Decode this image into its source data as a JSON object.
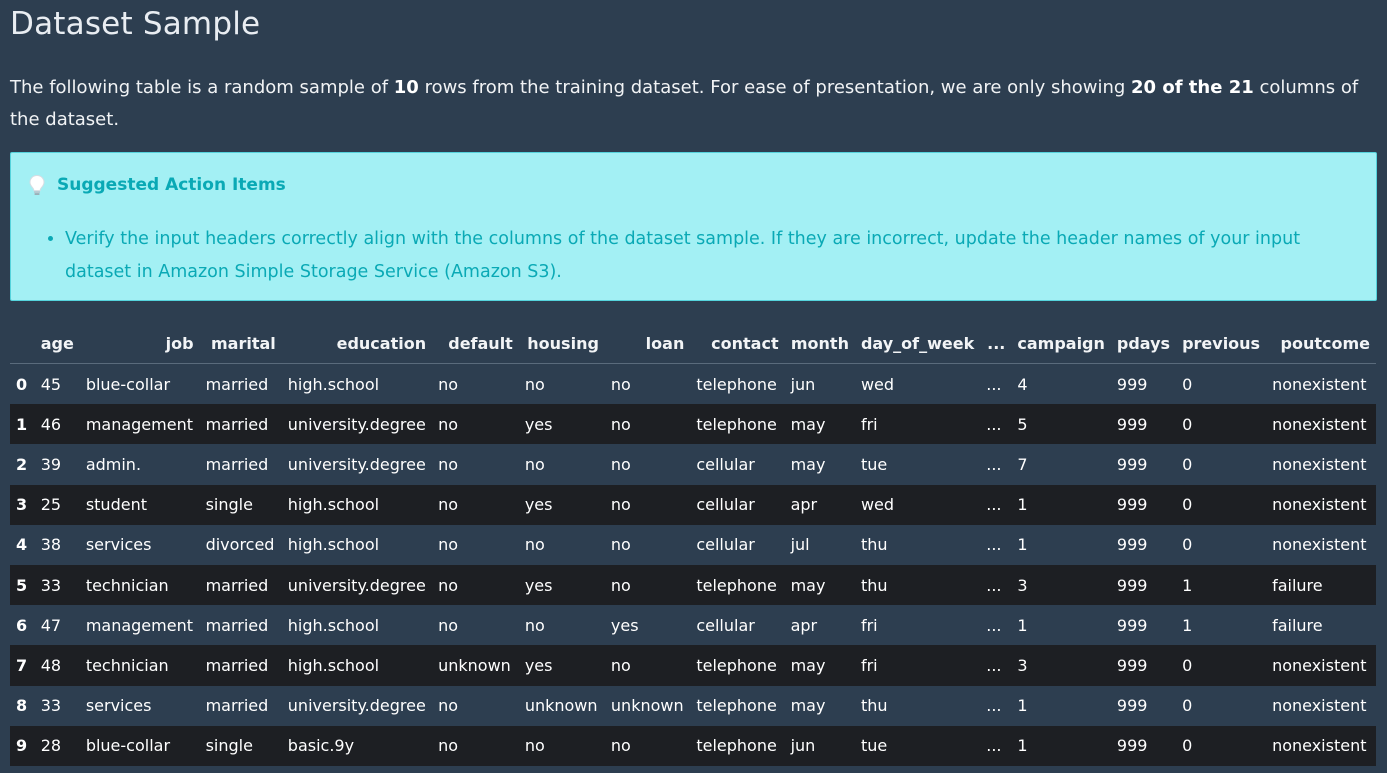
{
  "page": {
    "title": "Dataset Sample",
    "intro": {
      "part1": "The following table is a random sample of ",
      "rows_bold": "10",
      "part2": " rows from the training dataset. For ease of presentation, we are only showing ",
      "cols_bold": "20 of the 21",
      "part3": " columns of the dataset."
    }
  },
  "callout": {
    "icon": "lightbulb-icon",
    "title": "Suggested Action Items",
    "items": [
      "Verify the input headers correctly align with the columns of the dataset sample. If they are incorrect, update the header names of your input dataset in Amazon Simple Storage Service (Amazon S3)."
    ],
    "colors": {
      "background": "#a3f0f4",
      "text": "#0aa9b5",
      "border": "#55d3dc"
    }
  },
  "table": {
    "headers": [
      "",
      "age",
      "job",
      "marital",
      "education",
      "default",
      "housing",
      "loan",
      "contact",
      "month",
      "day_of_week",
      "...",
      "campaign",
      "pdays",
      "previous",
      "poutcome"
    ],
    "rows": [
      [
        "0",
        "45",
        "blue-collar",
        "married",
        "high.school",
        "no",
        "no",
        "no",
        "telephone",
        "jun",
        "wed",
        "...",
        "4",
        "999",
        "0",
        "nonexistent"
      ],
      [
        "1",
        "46",
        "management",
        "married",
        "university.degree",
        "no",
        "yes",
        "no",
        "telephone",
        "may",
        "fri",
        "...",
        "5",
        "999",
        "0",
        "nonexistent"
      ],
      [
        "2",
        "39",
        "admin.",
        "married",
        "university.degree",
        "no",
        "no",
        "no",
        "cellular",
        "may",
        "tue",
        "...",
        "7",
        "999",
        "0",
        "nonexistent"
      ],
      [
        "3",
        "25",
        "student",
        "single",
        "high.school",
        "no",
        "yes",
        "no",
        "cellular",
        "apr",
        "wed",
        "...",
        "1",
        "999",
        "0",
        "nonexistent"
      ],
      [
        "4",
        "38",
        "services",
        "divorced",
        "high.school",
        "no",
        "no",
        "no",
        "cellular",
        "jul",
        "thu",
        "...",
        "1",
        "999",
        "0",
        "nonexistent"
      ],
      [
        "5",
        "33",
        "technician",
        "married",
        "university.degree",
        "no",
        "yes",
        "no",
        "telephone",
        "may",
        "thu",
        "...",
        "3",
        "999",
        "1",
        "failure"
      ],
      [
        "6",
        "47",
        "management",
        "married",
        "high.school",
        "no",
        "no",
        "yes",
        "cellular",
        "apr",
        "fri",
        "...",
        "1",
        "999",
        "1",
        "failure"
      ],
      [
        "7",
        "48",
        "technician",
        "married",
        "high.school",
        "unknown",
        "yes",
        "no",
        "telephone",
        "may",
        "fri",
        "...",
        "3",
        "999",
        "0",
        "nonexistent"
      ],
      [
        "8",
        "33",
        "services",
        "married",
        "university.degree",
        "no",
        "unknown",
        "unknown",
        "telephone",
        "may",
        "thu",
        "...",
        "1",
        "999",
        "0",
        "nonexistent"
      ],
      [
        "9",
        "28",
        "blue-collar",
        "single",
        "basic.9y",
        "no",
        "no",
        "no",
        "telephone",
        "jun",
        "tue",
        "...",
        "1",
        "999",
        "0",
        "nonexistent"
      ]
    ]
  },
  "colors": {
    "page_background": "#2d3e50",
    "row_alt_background": "#1d1f23"
  }
}
